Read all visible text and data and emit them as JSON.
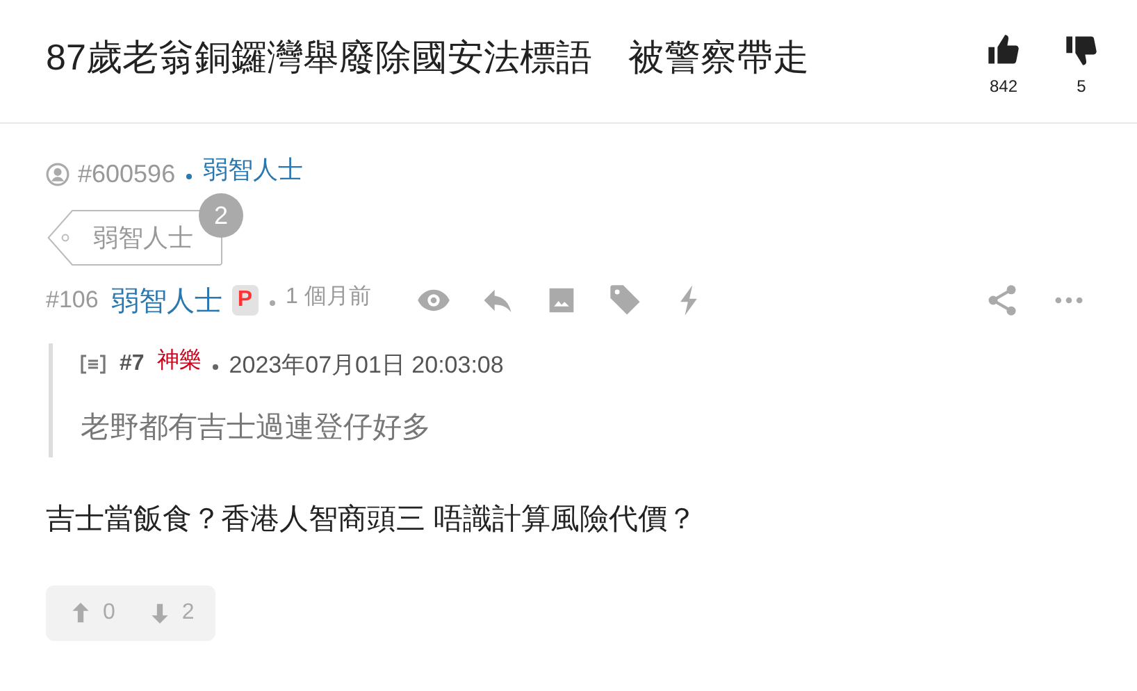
{
  "title": "87歲老翁銅鑼灣舉廢除國安法標語　被警察帶走",
  "reactions": [
    {
      "kind": "like",
      "count": "842"
    },
    {
      "kind": "dislike",
      "count": "5"
    }
  ],
  "author": {
    "id": "#600596",
    "name": "弱智人士"
  },
  "tag": {
    "label": "弱智人士",
    "count": "2"
  },
  "post": {
    "number": "#106",
    "name": "弱智人士",
    "badge": "P",
    "time": "1 個月前",
    "quote": {
      "number": "#7",
      "name": "神樂",
      "color": "#d0021b",
      "date": "2023年07月01日 20:03:08",
      "text": "老野都有吉士過連登仔好多"
    },
    "body": "吉士當飯食？香港人智商頭三 唔識計算風險代價？",
    "votes": [
      {
        "kind": "up",
        "count": "0"
      },
      {
        "kind": "down",
        "count": "2"
      }
    ]
  }
}
